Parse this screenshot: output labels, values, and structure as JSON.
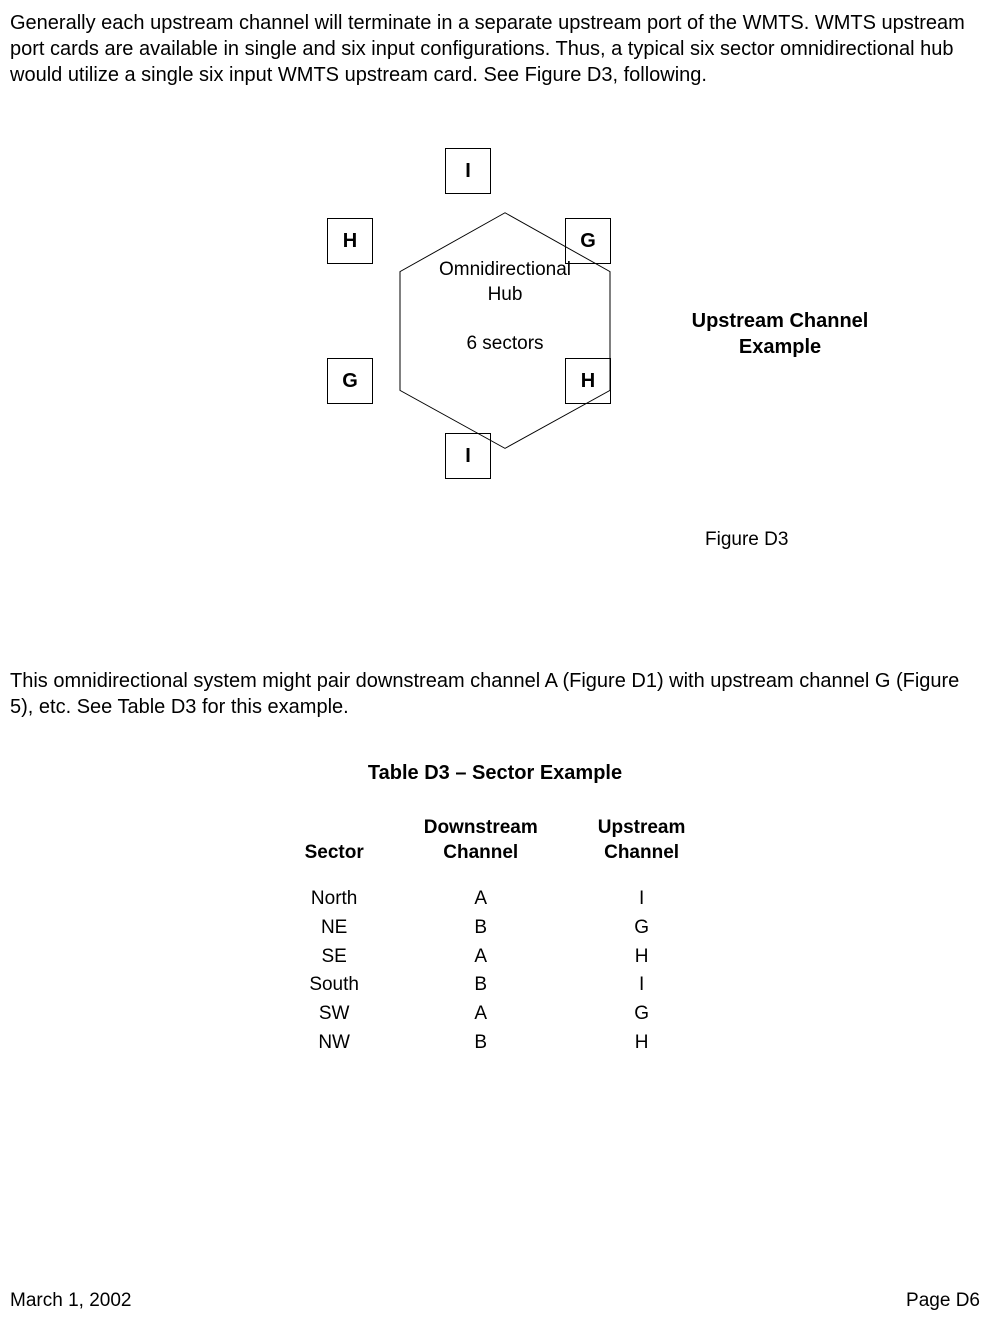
{
  "paragraph1": "Generally each upstream channel will terminate in a separate upstream port of the WMTS.  WMTS upstream port cards are available in single and six input configurations.  Thus, a typical six sector omnidirectional hub would utilize a single six input WMTS upstream card.  See Figure D3, following.",
  "diagram": {
    "hub_label_line1": "Omnidirectional",
    "hub_label_line2": "Hub",
    "hub_label_line3": "6 sectors",
    "sectors": {
      "top": "I",
      "top_right": "G",
      "bottom_right": "H",
      "bottom": "I",
      "bottom_left": "G",
      "top_left": "H"
    },
    "title_line1": "Upstream Channel",
    "title_line2": "Example",
    "caption": "Figure D3"
  },
  "paragraph2": "This omnidirectional system might pair downstream channel A (Figure D1) with upstream channel G (Figure 5), etc.  See Table D3 for this example.",
  "table": {
    "title": "Table D3 – Sector Example",
    "headers": {
      "col1": "Sector",
      "col2_line1": "Downstream",
      "col2_line2": "Channel",
      "col3_line1": "Upstream",
      "col3_line2": "Channel"
    },
    "rows": [
      {
        "sector": "North",
        "downstream": "A",
        "upstream": "I"
      },
      {
        "sector": "NE",
        "downstream": "B",
        "upstream": "G"
      },
      {
        "sector": "SE",
        "downstream": "A",
        "upstream": "H"
      },
      {
        "sector": "South",
        "downstream": "B",
        "upstream": "I"
      },
      {
        "sector": "SW",
        "downstream": "A",
        "upstream": "G"
      },
      {
        "sector": "NW",
        "downstream": "B",
        "upstream": "H"
      }
    ]
  },
  "footer": {
    "date": "March 1, 2002",
    "page": "Page D6"
  }
}
